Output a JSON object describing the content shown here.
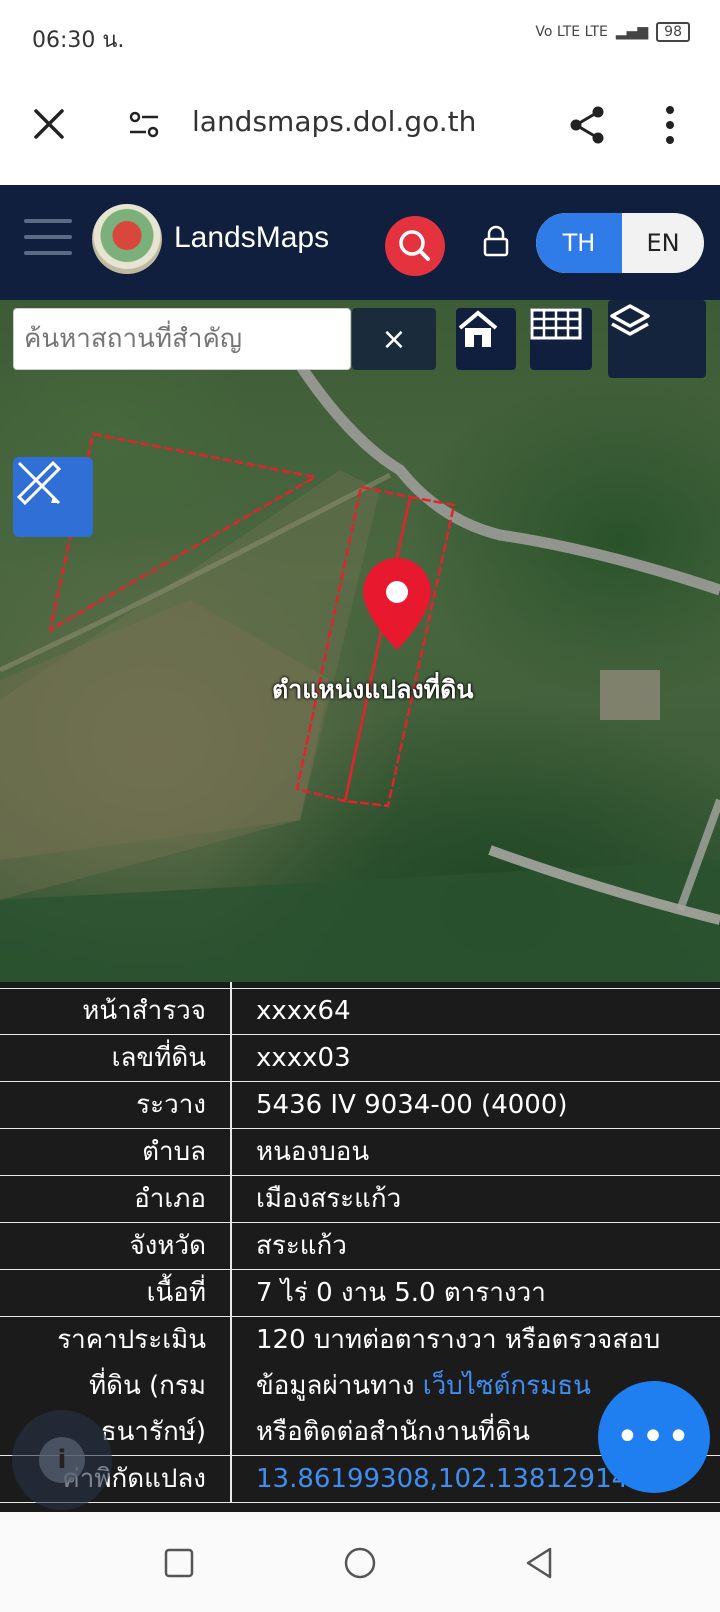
{
  "status_bar": {
    "time": "06:30 น.",
    "network": "Vo LTE LTE",
    "battery": "98"
  },
  "browser": {
    "url": "landsmaps.dol.go.th"
  },
  "header": {
    "app_name": "LandsMaps",
    "lang_th": "TH",
    "lang_en": "EN"
  },
  "map": {
    "search_placeholder": "ค้นหาสถานที่สำคัญ",
    "clear_label": "×",
    "pin_label": "ตำแหน่งแปลงที่ดิน"
  },
  "info": {
    "rows": [
      {
        "label": "หน้าสำรวจ",
        "value": "xxxx64"
      },
      {
        "label": "เลขที่ดิน",
        "value": "xxxx03"
      },
      {
        "label": "ระวาง",
        "value": "5436 IV 9034-00 (4000)"
      },
      {
        "label": "ตำบล",
        "value": "หนองบอน"
      },
      {
        "label": "อำเภอ",
        "value": "เมืองสระแก้ว"
      },
      {
        "label": "จังหวัด",
        "value": "สระแก้ว"
      },
      {
        "label": "เนื้อที่",
        "value": "7 ไร่ 0 งาน 5.0 ตารางวา"
      }
    ],
    "appraisal": {
      "label_1": "ราคาประเมิน",
      "label_2": "ที่ดิน (กรม",
      "label_3": "ธนารักษ์)",
      "value_1": "120 บาทต่อตารางวา หรือตรวจสอบ",
      "value_2a": "ข้อมูลผ่านทาง ",
      "value_2_link": "เว็บไซต์กรมธน",
      "value_3": "หรือติดต่อสำนักงานที่ดิน"
    },
    "coords": {
      "label": "ค่าพิกัดแปลง",
      "value": "13.86199308,102.13812914"
    }
  },
  "fab": {
    "label": "•••"
  },
  "info_fab": {
    "label": "i"
  },
  "colors": {
    "header_bg": "#0f1f3d",
    "accent": "#e5323f",
    "toggle_active": "#2f7be8",
    "fab": "#1f7ef0"
  }
}
